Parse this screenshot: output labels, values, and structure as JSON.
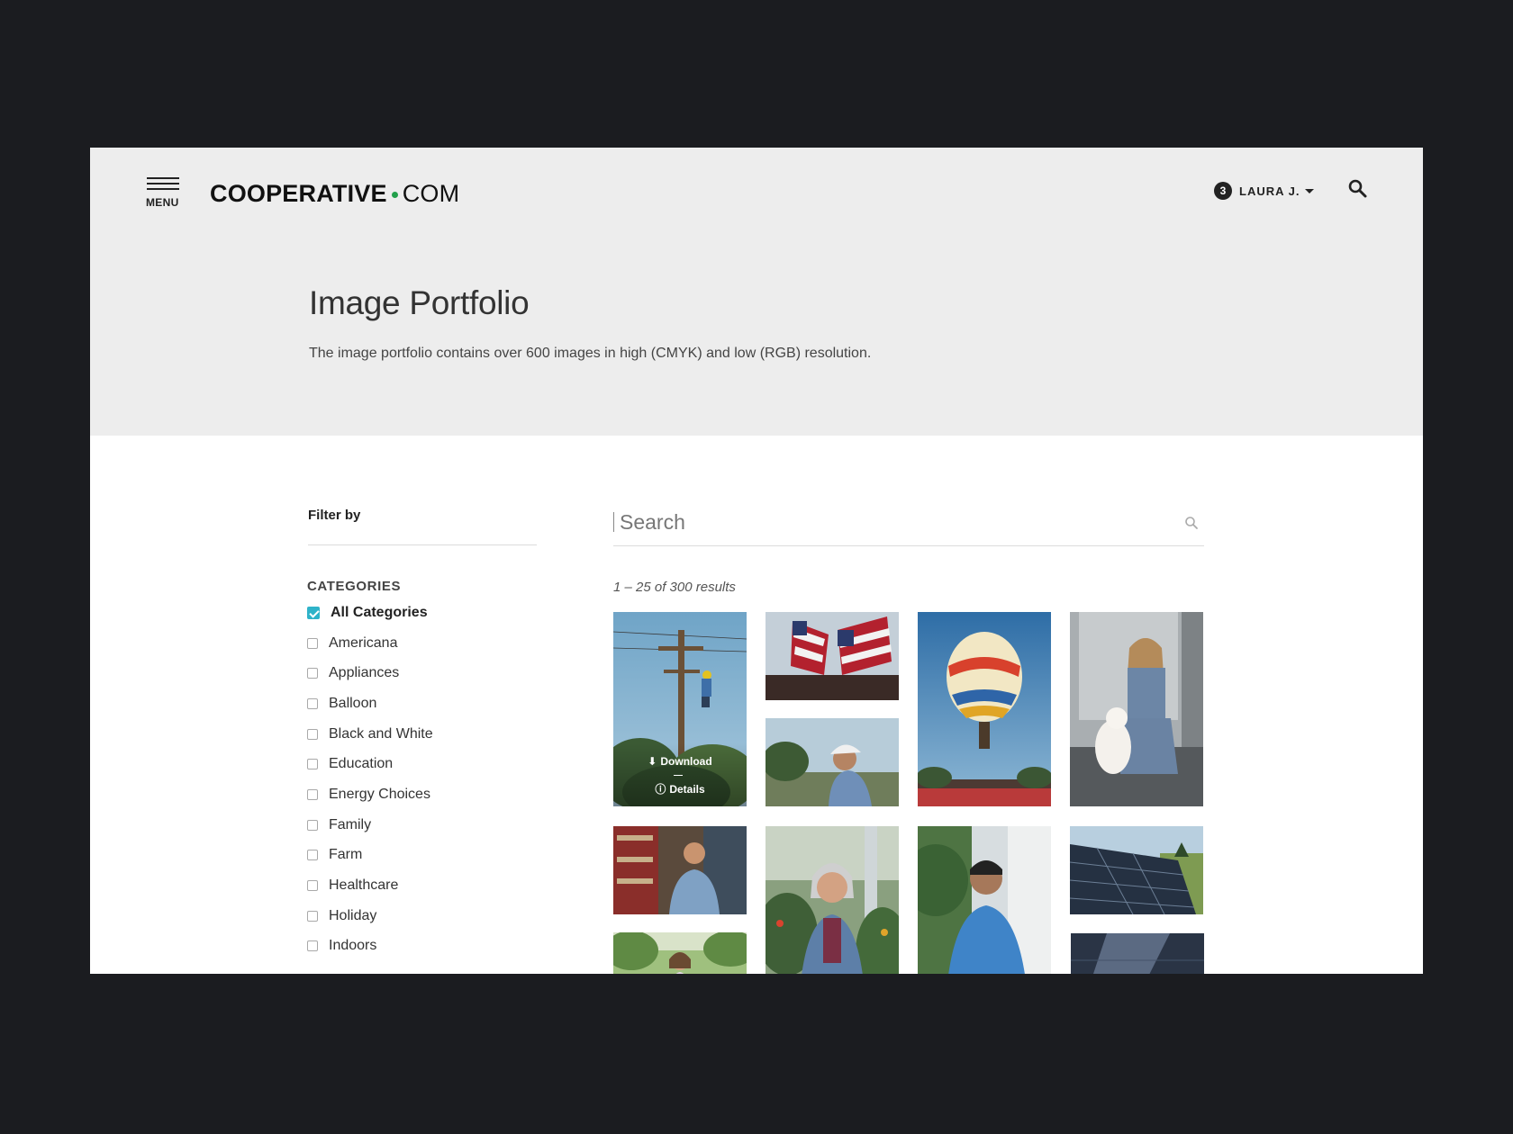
{
  "header": {
    "menu_label": "MENU",
    "logo_part1": "COOPERATIVE",
    "logo_part2": "COM",
    "notification_count": "3",
    "user_name": "LAURA J.",
    "brand_color": "#22a04b"
  },
  "hero": {
    "title": "Image Portfolio",
    "description": "The image portfolio contains over 600 images in high (CMYK) and low (RGB) resolution."
  },
  "filter": {
    "title": "Filter by",
    "categories_heading": "CATEGORIES",
    "categories": [
      {
        "label": "All Categories",
        "checked": true
      },
      {
        "label": "Americana",
        "checked": false
      },
      {
        "label": "Appliances",
        "checked": false
      },
      {
        "label": "Balloon",
        "checked": false
      },
      {
        "label": "Black and White",
        "checked": false
      },
      {
        "label": "Education",
        "checked": false
      },
      {
        "label": "Energy Choices",
        "checked": false
      },
      {
        "label": "Family",
        "checked": false
      },
      {
        "label": "Farm",
        "checked": false
      },
      {
        "label": "Healthcare",
        "checked": false
      },
      {
        "label": "Holiday",
        "checked": false
      },
      {
        "label": "Indoors",
        "checked": false
      }
    ],
    "accent_color": "#2fb3c9"
  },
  "search": {
    "placeholder": "Search",
    "value": ""
  },
  "results": {
    "summary": "1 – 25 of 300 results"
  },
  "gallery": {
    "hover_actions": {
      "download_label": "Download",
      "details_label": "Details"
    },
    "images": [
      {
        "subject": "lineman on utility pole"
      },
      {
        "subject": "american flags"
      },
      {
        "subject": "worker in hard hat"
      },
      {
        "subject": "hot air balloon"
      },
      {
        "subject": "girl with puppy"
      },
      {
        "subject": "man in workshop"
      },
      {
        "subject": "woman outdoors"
      },
      {
        "subject": "senior woman in garden"
      },
      {
        "subject": "man in blue polo"
      },
      {
        "subject": "solar panel"
      },
      {
        "subject": "solar panel close-up"
      }
    ]
  }
}
